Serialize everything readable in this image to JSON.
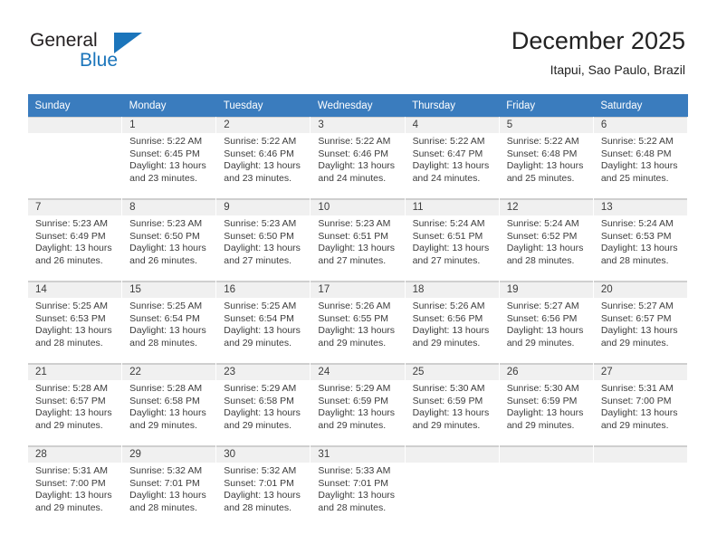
{
  "brand": {
    "line1": "General",
    "line2": "Blue",
    "triangle_icon": "triangle-icon",
    "color_dark": "#231f20",
    "color_blue": "#1b75bb"
  },
  "header": {
    "title": "December 2025",
    "subtitle": "Itapui, Sao Paulo, Brazil"
  },
  "calendar": {
    "header_bg": "#3a7cbe",
    "daynum_bg": "#f0f0f0",
    "weekdays": [
      "Sunday",
      "Monday",
      "Tuesday",
      "Wednesday",
      "Thursday",
      "Friday",
      "Saturday"
    ],
    "weeks": [
      [
        {
          "day": "",
          "lines": [
            "",
            "",
            "",
            ""
          ]
        },
        {
          "day": "1",
          "lines": [
            "Sunrise: 5:22 AM",
            "Sunset: 6:45 PM",
            "Daylight: 13 hours",
            "and 23 minutes."
          ]
        },
        {
          "day": "2",
          "lines": [
            "Sunrise: 5:22 AM",
            "Sunset: 6:46 PM",
            "Daylight: 13 hours",
            "and 23 minutes."
          ]
        },
        {
          "day": "3",
          "lines": [
            "Sunrise: 5:22 AM",
            "Sunset: 6:46 PM",
            "Daylight: 13 hours",
            "and 24 minutes."
          ]
        },
        {
          "day": "4",
          "lines": [
            "Sunrise: 5:22 AM",
            "Sunset: 6:47 PM",
            "Daylight: 13 hours",
            "and 24 minutes."
          ]
        },
        {
          "day": "5",
          "lines": [
            "Sunrise: 5:22 AM",
            "Sunset: 6:48 PM",
            "Daylight: 13 hours",
            "and 25 minutes."
          ]
        },
        {
          "day": "6",
          "lines": [
            "Sunrise: 5:22 AM",
            "Sunset: 6:48 PM",
            "Daylight: 13 hours",
            "and 25 minutes."
          ]
        }
      ],
      [
        {
          "day": "7",
          "lines": [
            "Sunrise: 5:23 AM",
            "Sunset: 6:49 PM",
            "Daylight: 13 hours",
            "and 26 minutes."
          ]
        },
        {
          "day": "8",
          "lines": [
            "Sunrise: 5:23 AM",
            "Sunset: 6:50 PM",
            "Daylight: 13 hours",
            "and 26 minutes."
          ]
        },
        {
          "day": "9",
          "lines": [
            "Sunrise: 5:23 AM",
            "Sunset: 6:50 PM",
            "Daylight: 13 hours",
            "and 27 minutes."
          ]
        },
        {
          "day": "10",
          "lines": [
            "Sunrise: 5:23 AM",
            "Sunset: 6:51 PM",
            "Daylight: 13 hours",
            "and 27 minutes."
          ]
        },
        {
          "day": "11",
          "lines": [
            "Sunrise: 5:24 AM",
            "Sunset: 6:51 PM",
            "Daylight: 13 hours",
            "and 27 minutes."
          ]
        },
        {
          "day": "12",
          "lines": [
            "Sunrise: 5:24 AM",
            "Sunset: 6:52 PM",
            "Daylight: 13 hours",
            "and 28 minutes."
          ]
        },
        {
          "day": "13",
          "lines": [
            "Sunrise: 5:24 AM",
            "Sunset: 6:53 PM",
            "Daylight: 13 hours",
            "and 28 minutes."
          ]
        }
      ],
      [
        {
          "day": "14",
          "lines": [
            "Sunrise: 5:25 AM",
            "Sunset: 6:53 PM",
            "Daylight: 13 hours",
            "and 28 minutes."
          ]
        },
        {
          "day": "15",
          "lines": [
            "Sunrise: 5:25 AM",
            "Sunset: 6:54 PM",
            "Daylight: 13 hours",
            "and 28 minutes."
          ]
        },
        {
          "day": "16",
          "lines": [
            "Sunrise: 5:25 AM",
            "Sunset: 6:54 PM",
            "Daylight: 13 hours",
            "and 29 minutes."
          ]
        },
        {
          "day": "17",
          "lines": [
            "Sunrise: 5:26 AM",
            "Sunset: 6:55 PM",
            "Daylight: 13 hours",
            "and 29 minutes."
          ]
        },
        {
          "day": "18",
          "lines": [
            "Sunrise: 5:26 AM",
            "Sunset: 6:56 PM",
            "Daylight: 13 hours",
            "and 29 minutes."
          ]
        },
        {
          "day": "19",
          "lines": [
            "Sunrise: 5:27 AM",
            "Sunset: 6:56 PM",
            "Daylight: 13 hours",
            "and 29 minutes."
          ]
        },
        {
          "day": "20",
          "lines": [
            "Sunrise: 5:27 AM",
            "Sunset: 6:57 PM",
            "Daylight: 13 hours",
            "and 29 minutes."
          ]
        }
      ],
      [
        {
          "day": "21",
          "lines": [
            "Sunrise: 5:28 AM",
            "Sunset: 6:57 PM",
            "Daylight: 13 hours",
            "and 29 minutes."
          ]
        },
        {
          "day": "22",
          "lines": [
            "Sunrise: 5:28 AM",
            "Sunset: 6:58 PM",
            "Daylight: 13 hours",
            "and 29 minutes."
          ]
        },
        {
          "day": "23",
          "lines": [
            "Sunrise: 5:29 AM",
            "Sunset: 6:58 PM",
            "Daylight: 13 hours",
            "and 29 minutes."
          ]
        },
        {
          "day": "24",
          "lines": [
            "Sunrise: 5:29 AM",
            "Sunset: 6:59 PM",
            "Daylight: 13 hours",
            "and 29 minutes."
          ]
        },
        {
          "day": "25",
          "lines": [
            "Sunrise: 5:30 AM",
            "Sunset: 6:59 PM",
            "Daylight: 13 hours",
            "and 29 minutes."
          ]
        },
        {
          "day": "26",
          "lines": [
            "Sunrise: 5:30 AM",
            "Sunset: 6:59 PM",
            "Daylight: 13 hours",
            "and 29 minutes."
          ]
        },
        {
          "day": "27",
          "lines": [
            "Sunrise: 5:31 AM",
            "Sunset: 7:00 PM",
            "Daylight: 13 hours",
            "and 29 minutes."
          ]
        }
      ],
      [
        {
          "day": "28",
          "lines": [
            "Sunrise: 5:31 AM",
            "Sunset: 7:00 PM",
            "Daylight: 13 hours",
            "and 29 minutes."
          ]
        },
        {
          "day": "29",
          "lines": [
            "Sunrise: 5:32 AM",
            "Sunset: 7:01 PM",
            "Daylight: 13 hours",
            "and 28 minutes."
          ]
        },
        {
          "day": "30",
          "lines": [
            "Sunrise: 5:32 AM",
            "Sunset: 7:01 PM",
            "Daylight: 13 hours",
            "and 28 minutes."
          ]
        },
        {
          "day": "31",
          "lines": [
            "Sunrise: 5:33 AM",
            "Sunset: 7:01 PM",
            "Daylight: 13 hours",
            "and 28 minutes."
          ]
        },
        {
          "day": "",
          "lines": [
            "",
            "",
            "",
            ""
          ]
        },
        {
          "day": "",
          "lines": [
            "",
            "",
            "",
            ""
          ]
        },
        {
          "day": "",
          "lines": [
            "",
            "",
            "",
            ""
          ]
        }
      ]
    ]
  }
}
